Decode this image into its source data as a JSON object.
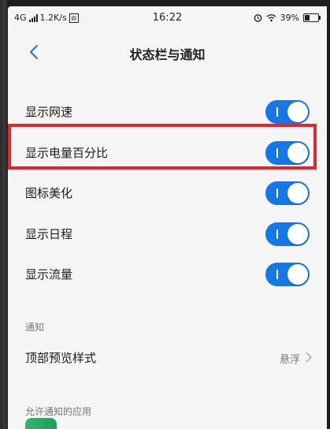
{
  "status_bar": {
    "network": "4G",
    "speed": "1.2K/s",
    "sim_icon": "sim-card-icon",
    "time": "16:22",
    "alarm_icon": "alarm-icon",
    "wifi_icon": "wifi-icon",
    "battery_percent": "39%",
    "battery_level": 0.39
  },
  "header": {
    "back_icon": "back-arrow-icon",
    "title": "状态栏与通知"
  },
  "settings": [
    {
      "label": "显示网速",
      "enabled": true
    },
    {
      "label": "显示电量百分比",
      "enabled": true,
      "highlighted": true
    },
    {
      "label": "图标美化",
      "enabled": true
    },
    {
      "label": "显示日程",
      "enabled": true
    },
    {
      "label": "显示流量",
      "enabled": true
    }
  ],
  "notification_section": {
    "header": "通知",
    "preview_style": {
      "label": "顶部预览样式",
      "value": "悬浮"
    },
    "allowed_apps_header": "允许通知的应用"
  },
  "colors": {
    "toggle_on": "#1677e6",
    "highlight_border": "#e8242b",
    "background": "#f5f5f5",
    "back_arrow": "#1677e6"
  }
}
